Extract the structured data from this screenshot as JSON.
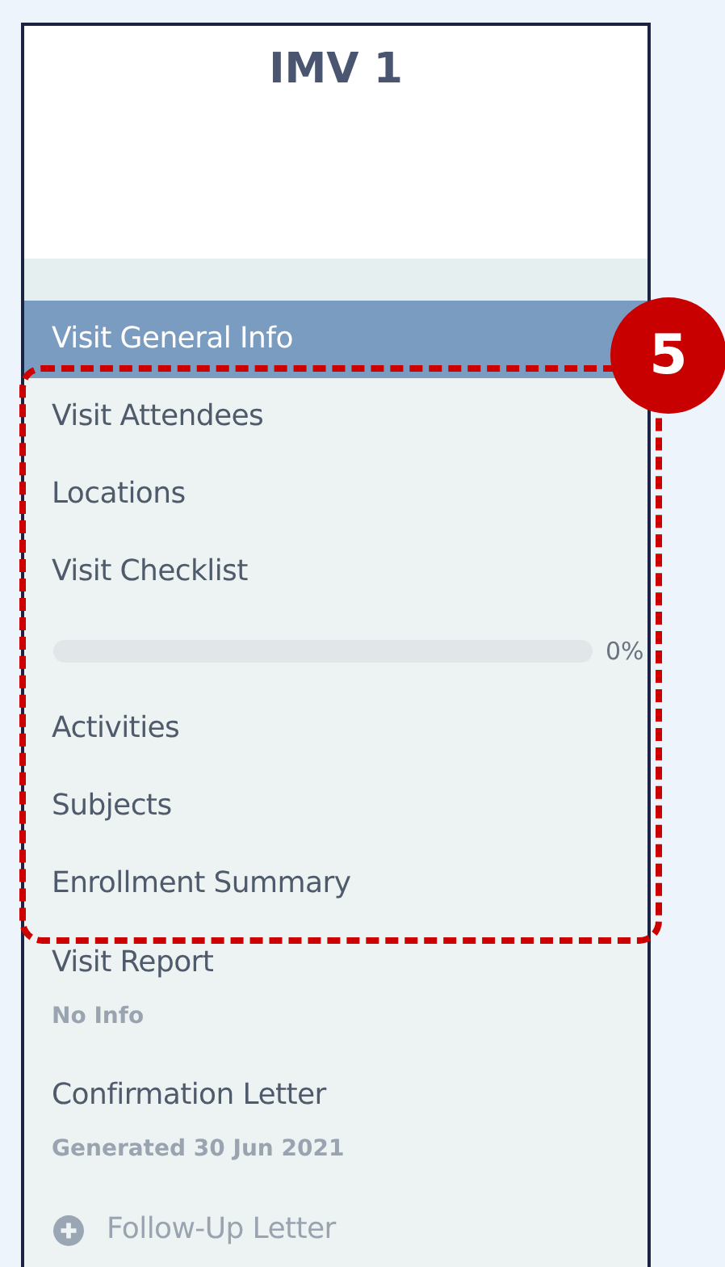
{
  "panel": {
    "title": "IMV 1"
  },
  "nav_items": [
    {
      "kind": "item",
      "label": "Visit General Info",
      "selected": true
    },
    {
      "kind": "item",
      "label": "Visit Attendees",
      "selected": false
    },
    {
      "kind": "item",
      "label": "Locations",
      "selected": false
    },
    {
      "kind": "item",
      "label": "Visit Checklist",
      "selected": false
    },
    {
      "kind": "progress",
      "reading": "0%"
    },
    {
      "kind": "item",
      "label": "Activities",
      "selected": false
    },
    {
      "kind": "item",
      "label": "Subjects",
      "selected": false
    },
    {
      "kind": "item",
      "label": "Enrollment Summary",
      "selected": false
    },
    {
      "kind": "item_with_sub",
      "label": "Visit Report",
      "sub": "No Info",
      "selected": false
    },
    {
      "kind": "item_with_sub",
      "label": "Confirmation Letter",
      "sub": "Generated 30 Jun 2021",
      "selected": false
    },
    {
      "kind": "add",
      "label": "Follow-Up Letter"
    }
  ],
  "annotation": {
    "number": "5"
  }
}
